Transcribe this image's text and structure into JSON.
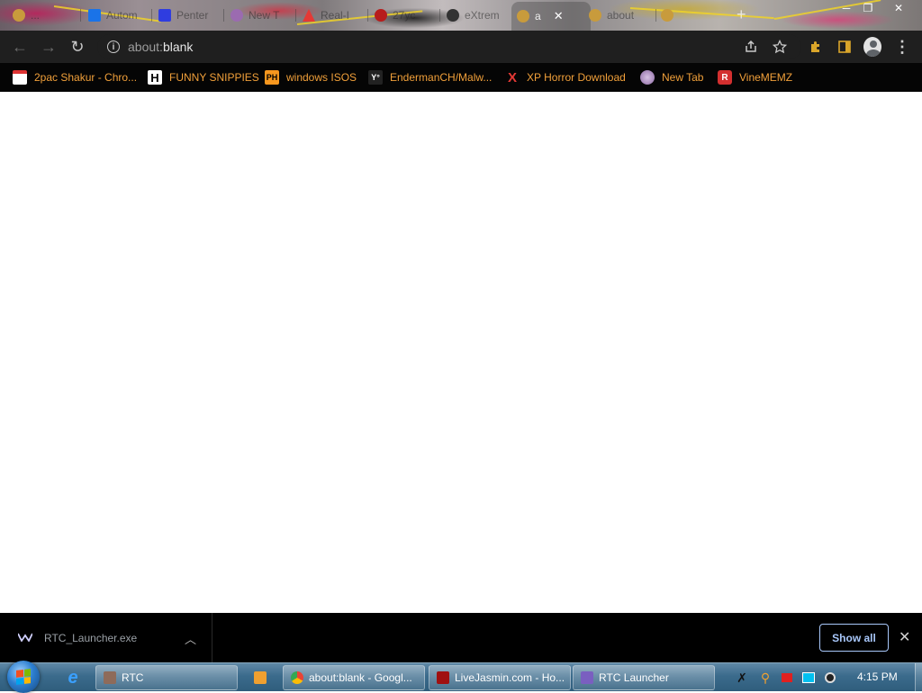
{
  "tabs": [
    {
      "label": "...",
      "color": "#c89b3c"
    },
    {
      "label": "Autom",
      "color": "#1a73e8"
    },
    {
      "label": "Penter",
      "color": "#2f3de0"
    },
    {
      "label": "New T",
      "color": "#9b6bb0"
    },
    {
      "label": "Real-I",
      "color": "#e53935"
    },
    {
      "label": "27yc",
      "color": "#b71c1c"
    },
    {
      "label": "eXtrem",
      "color": "#333333"
    },
    {
      "label": "a",
      "color": "#c89b3c"
    },
    {
      "label": "about",
      "color": "#c89b3c"
    },
    {
      "label": "",
      "color": "#c89b3c"
    }
  ],
  "toolbar": {
    "url_scheme": "about:",
    "url_rest": "blank"
  },
  "bookmarks": [
    {
      "label": "2pac Shakur - Chro...",
      "icon": "calendar-icon",
      "icon_text": "",
      "color": "#d33"
    },
    {
      "label": "FUNNY SNIPPIES",
      "icon": "h-icon",
      "icon_text": "H",
      "color": "#ffffff"
    },
    {
      "label": "windows ISOS",
      "icon": "ph-icon",
      "icon_text": "PH",
      "color": "#f7971e"
    },
    {
      "label": "EndermanCH/Malw...",
      "icon": "yp-icon",
      "icon_text": "Y°",
      "color": "#222"
    },
    {
      "label": "XP Horror Download",
      "icon": "x-icon",
      "icon_text": "X",
      "color": "#000"
    },
    {
      "label": "New Tab",
      "icon": "globe-icon",
      "icon_text": "",
      "color": "#b08ac0"
    },
    {
      "label": "VineMEMZ",
      "icon": "r-icon",
      "icon_text": "R",
      "color": "#d32f2f"
    }
  ],
  "download": {
    "filename": "RTC_Launcher.exe",
    "show_all": "Show all"
  },
  "taskbar": {
    "tasks": [
      {
        "label": "RTC",
        "color": "#8e6b5a"
      },
      {
        "label": "about:blank - Googl...",
        "color": "#4285f4"
      },
      {
        "label": "LiveJasmin.com - Ho...",
        "color": "#a01010"
      },
      {
        "label": "RTC Launcher",
        "color": "#7a5fc0"
      }
    ],
    "clock": "4:15 PM"
  }
}
